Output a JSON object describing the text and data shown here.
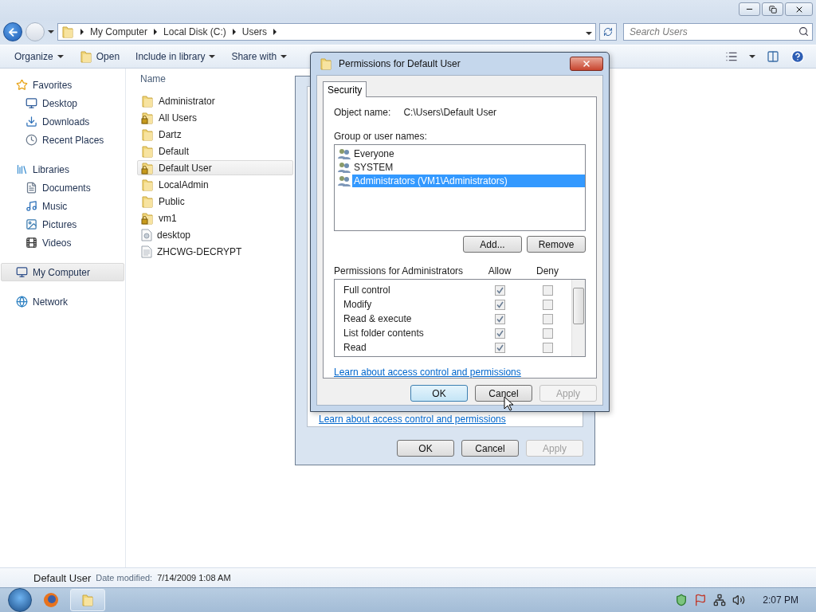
{
  "address": {
    "breadcrumbs": [
      "My Computer",
      "Local Disk (C:)",
      "Users"
    ]
  },
  "search": {
    "placeholder": "Search Users"
  },
  "toolbar": [
    {
      "label": "Organize",
      "dropdown": true
    },
    {
      "label": "Open",
      "dropdown": false
    },
    {
      "label": "Include in library",
      "dropdown": true
    },
    {
      "label": "Share with",
      "dropdown": true
    }
  ],
  "sidebar": [
    {
      "label": "Favorites",
      "selected": false,
      "children": [
        {
          "label": "Desktop",
          "selected": false
        },
        {
          "label": "Downloads",
          "selected": false
        },
        {
          "label": "Recent Places",
          "selected": false
        }
      ]
    },
    {
      "label": "Libraries",
      "selected": false,
      "children": [
        {
          "label": "Documents",
          "selected": false
        },
        {
          "label": "Music",
          "selected": false
        },
        {
          "label": "Pictures",
          "selected": false
        },
        {
          "label": "Videos",
          "selected": false
        }
      ]
    },
    {
      "label": "My Computer",
      "selected": true
    },
    {
      "label": "Network",
      "selected": false
    }
  ],
  "file_list": {
    "column": "Name",
    "files": [
      {
        "name": "Administrator",
        "kind": "folder",
        "selected": false
      },
      {
        "name": "All Users",
        "kind": "locked-folder",
        "selected": false
      },
      {
        "name": "Dartz",
        "kind": "folder",
        "selected": false
      },
      {
        "name": "Default",
        "kind": "folder",
        "selected": false
      },
      {
        "name": "Default User",
        "kind": "locked-folder",
        "selected": true
      },
      {
        "name": "LocalAdmin",
        "kind": "folder",
        "selected": false
      },
      {
        "name": "Public",
        "kind": "folder",
        "selected": false
      },
      {
        "name": "vm1",
        "kind": "locked-folder",
        "selected": false
      },
      {
        "name": "desktop",
        "kind": "settings-file",
        "selected": false
      },
      {
        "name": "ZHCWG-DECRYPT",
        "kind": "text-file",
        "selected": false
      }
    ]
  },
  "details": {
    "name": "Default User",
    "label": "Date modified:",
    "value": "7/14/2009 1:08 AM"
  },
  "taskbar": {
    "clock": "2:07 PM"
  },
  "properties_dialog": {
    "link": "Learn about access control and permissions",
    "buttons": [
      {
        "label": "OK",
        "disabled": false
      },
      {
        "label": "Cancel",
        "disabled": false
      },
      {
        "label": "Apply",
        "disabled": true
      }
    ]
  },
  "permissions_dialog": {
    "title": "Permissions for Default User",
    "tabs": [
      {
        "label": "Security",
        "selected": true
      }
    ],
    "object_label": "Object name:",
    "object_value": "C:\\Users\\Default User",
    "group_label": "Group or user names:",
    "users": [
      {
        "name": "Everyone",
        "selected": false
      },
      {
        "name": "SYSTEM",
        "selected": false
      },
      {
        "name": "Administrators (VM1\\Administrators)",
        "selected": true
      }
    ],
    "user_buttons": [
      "Add...",
      "Remove"
    ],
    "permissions_label": "Permissions for Administrators",
    "allow_header": "Allow",
    "deny_header": "Deny",
    "permissions": [
      {
        "name": "Full control",
        "allow": true,
        "deny": false
      },
      {
        "name": "Modify",
        "allow": true,
        "deny": false
      },
      {
        "name": "Read & execute",
        "allow": true,
        "deny": false
      },
      {
        "name": "List folder contents",
        "allow": true,
        "deny": false
      },
      {
        "name": "Read",
        "allow": true,
        "deny": false
      }
    ],
    "link": "Learn about access control and permissions",
    "buttons": [
      {
        "label": "OK",
        "default": true,
        "disabled": false
      },
      {
        "label": "Cancel",
        "default": false,
        "disabled": false
      },
      {
        "label": "Apply",
        "default": false,
        "disabled": true
      }
    ]
  }
}
